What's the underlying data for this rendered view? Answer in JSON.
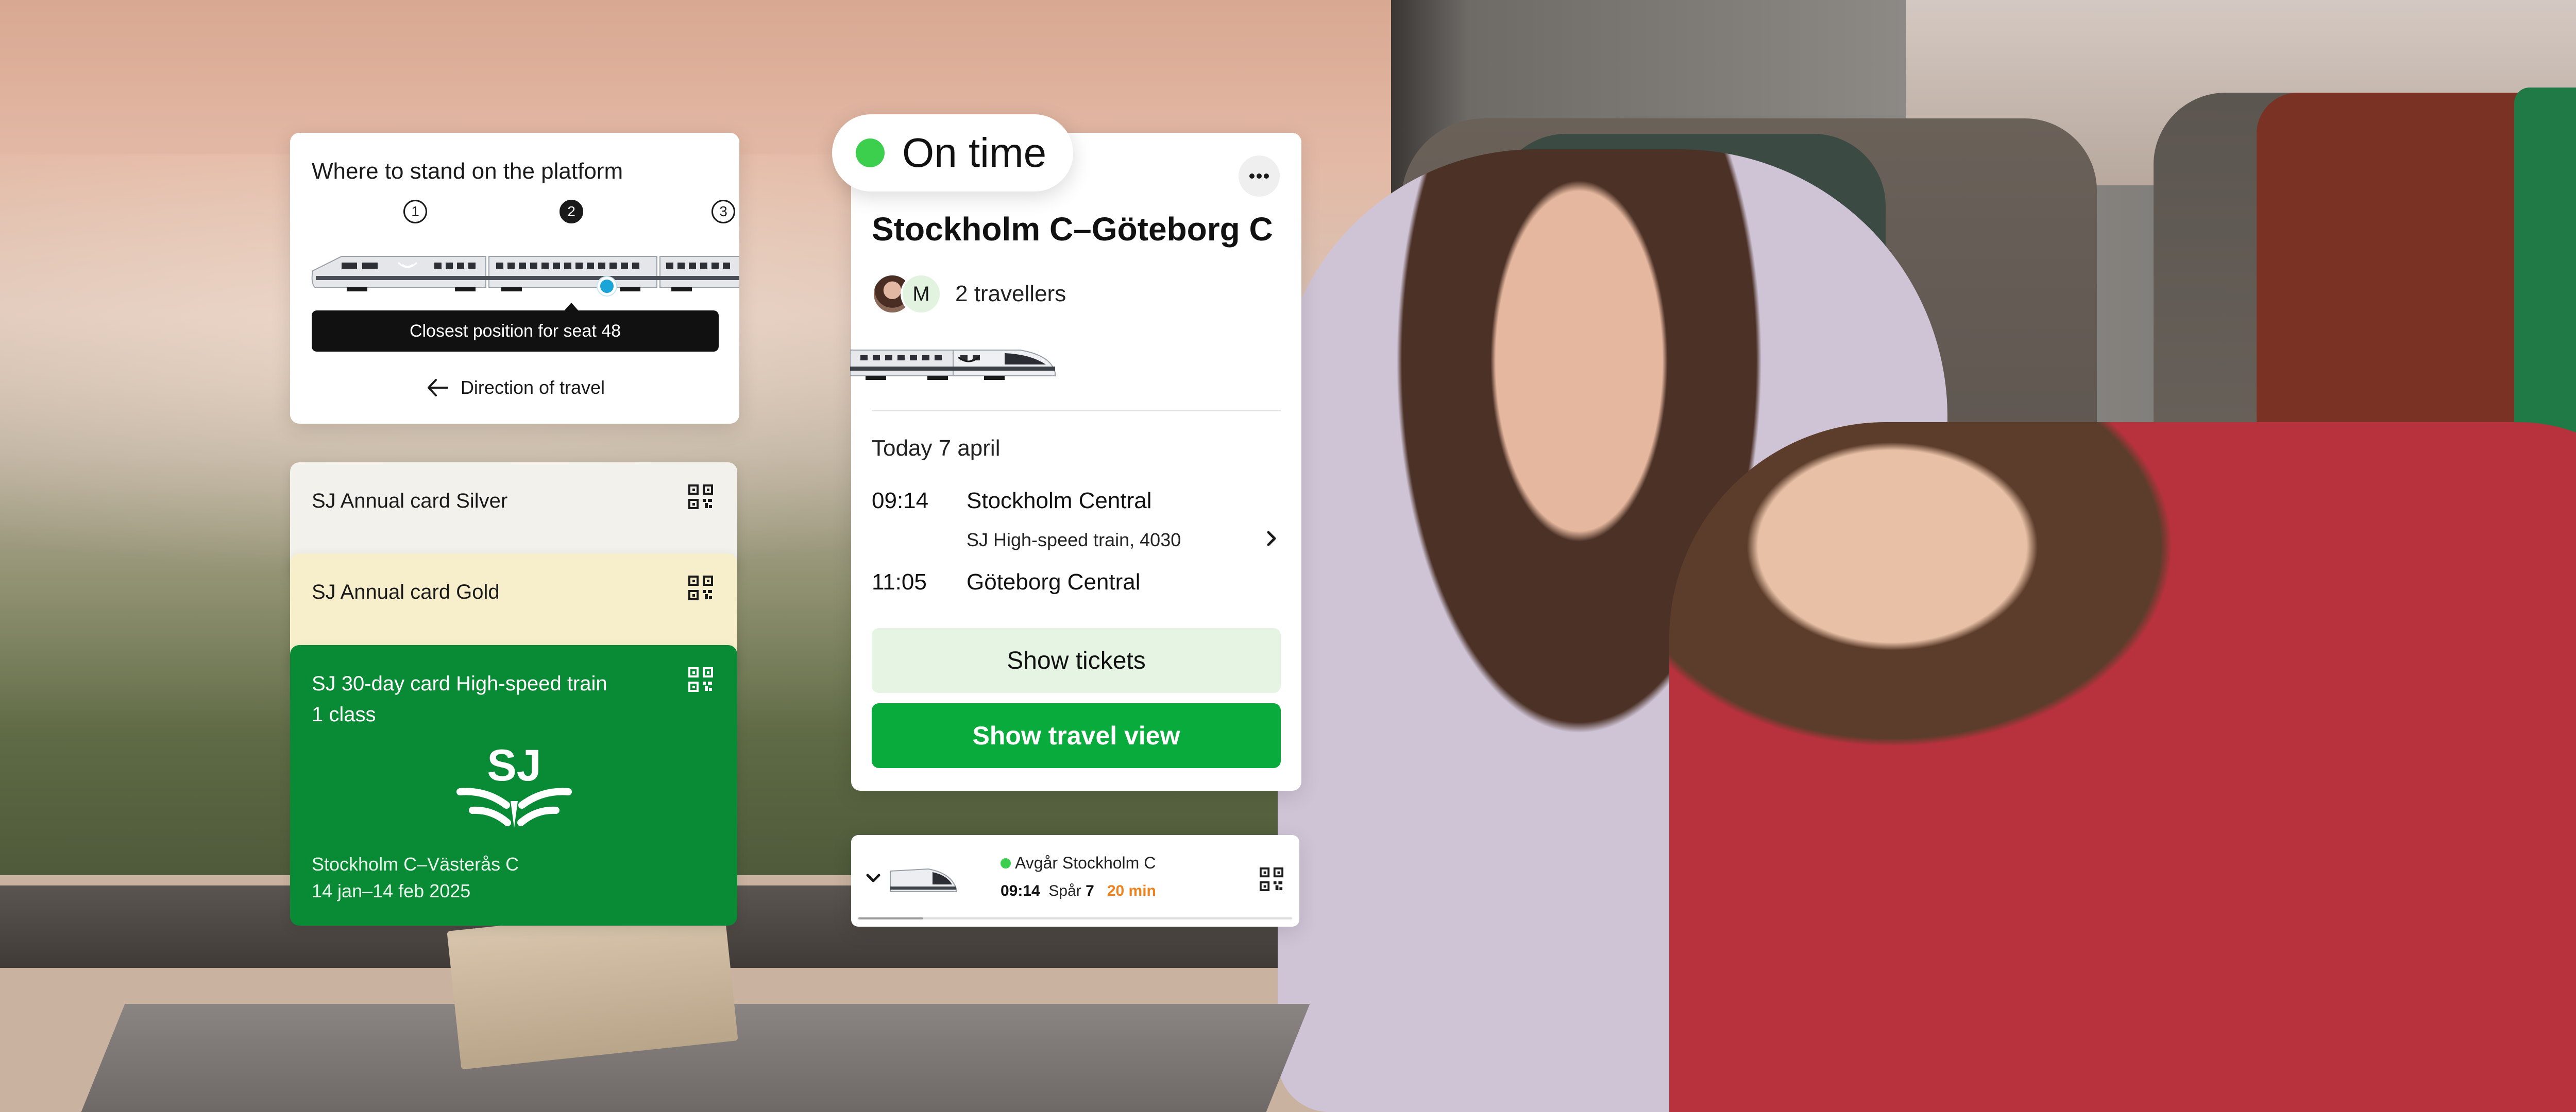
{
  "platform_card": {
    "title": "Where to stand on the platform",
    "coaches": [
      "1",
      "2",
      "3"
    ],
    "active_coach": "2",
    "closest_label": "Closest position for seat 48",
    "direction_label": "Direction of travel"
  },
  "passes": [
    {
      "label": "SJ Annual card Silver"
    },
    {
      "label": "SJ Annual card Gold"
    },
    {
      "label_line1": "SJ 30-day card High-speed train",
      "label_line2": "1 class",
      "route": "Stockholm C–Västerås C",
      "validity": "14 jan–14 feb 2025"
    }
  ],
  "journey": {
    "status": "On time",
    "title": "Stockholm C–Göteborg C",
    "avatar_initial": "M",
    "travellers": "2 travellers",
    "date": "Today 7 april",
    "departure": {
      "time": "09:14",
      "station": "Stockholm Central"
    },
    "service": "SJ High-speed train, 4030",
    "arrival": {
      "time": "11:05",
      "station": "Göteborg Central"
    },
    "show_tickets": "Show tickets",
    "show_travel_view": "Show travel view"
  },
  "mini_widget": {
    "status": "Avgår Stockholm C",
    "time": "09:14",
    "track_label": "Spår",
    "track": "7",
    "countdown": "20 min",
    "progress": 0.15
  },
  "colors": {
    "accent_green": "#09ab3c",
    "dark_green": "#098a35",
    "status_green": "#3ccf4e",
    "delay_orange": "#f0821e",
    "seat_blue": "#1aa5d8"
  },
  "icons": [
    "qr-code-icon",
    "more-dots-icon",
    "arrow-left-icon",
    "chevron-right-icon",
    "chevron-down-icon",
    "train-icon",
    "sj-logo"
  ]
}
